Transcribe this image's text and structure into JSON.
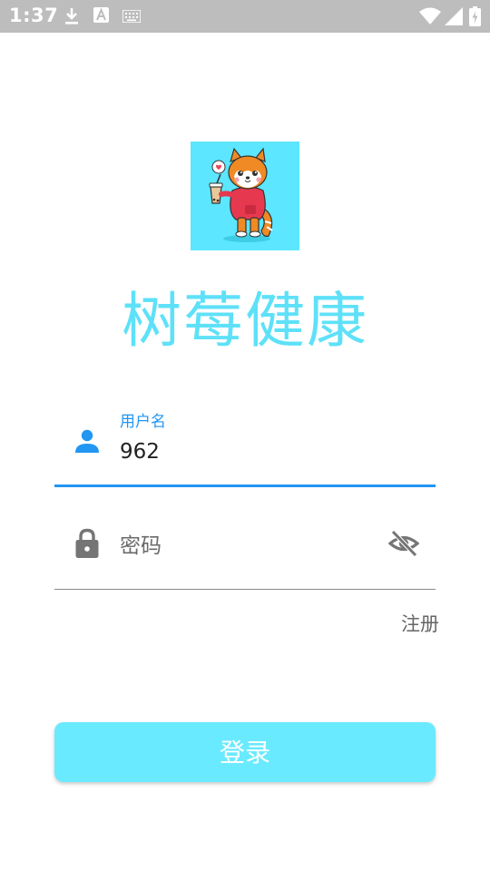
{
  "status_bar": {
    "time": "1:37",
    "left_icons": [
      "download-icon",
      "a-badge-icon",
      "keyboard-icon"
    ],
    "right_icons": [
      "wifi-icon",
      "signal-icon",
      "battery-charging-icon"
    ]
  },
  "app": {
    "title": "树莓健康",
    "logo_icon": "shiba-dog-mascot-logo",
    "title_color": "#5ee1f8"
  },
  "form": {
    "username": {
      "label": "用户名",
      "value": "962",
      "icon": "person-icon",
      "accent": "#2196f3"
    },
    "password": {
      "placeholder": "密码",
      "icon": "lock-icon",
      "toggle_icon": "eye-off-icon"
    },
    "register_label": "注册",
    "login_label": "登录",
    "button_color": "#6aeaff"
  }
}
